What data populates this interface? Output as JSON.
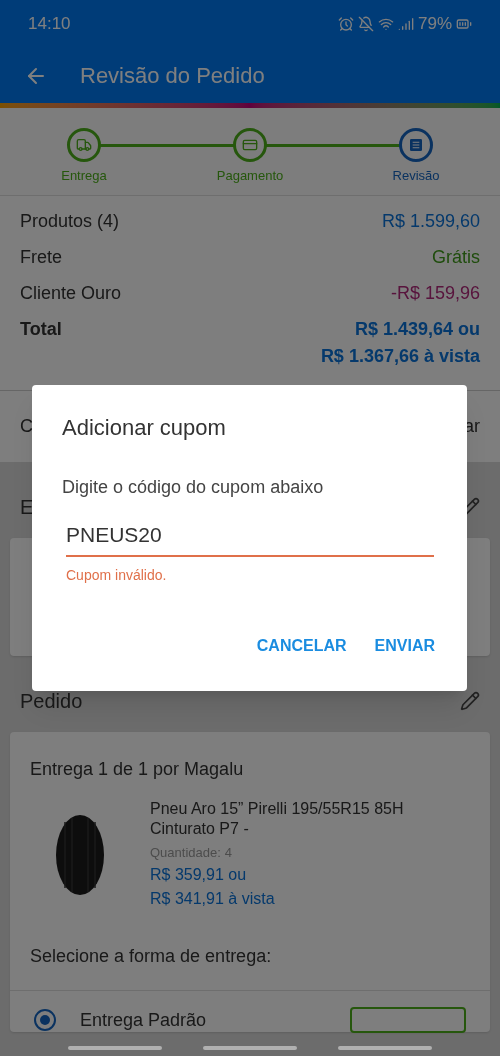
{
  "status_bar": {
    "time": "14:10",
    "battery": "79%"
  },
  "app_bar": {
    "title": "Revisão do Pedido"
  },
  "steps": [
    {
      "label": "Entrega",
      "kind": "truck",
      "selected": false
    },
    {
      "label": "Pagamento",
      "kind": "card",
      "selected": false
    },
    {
      "label": "Revisão",
      "kind": "list",
      "selected": true
    }
  ],
  "summary": [
    {
      "label": "Produtos (4)",
      "value": "R$ 1.599,60",
      "kind": "price"
    },
    {
      "label": "Frete",
      "value": "Grátis",
      "kind": "free"
    },
    {
      "label": "Cliente Ouro",
      "value": "-R$ 159,96",
      "kind": "discount"
    }
  ],
  "total": {
    "label": "Total",
    "values": [
      "R$ 1.439,64 ou",
      "R$ 1.367,66 à vista"
    ]
  },
  "coupon_row": {
    "left": "C",
    "right": "ar"
  },
  "delivery_section": {
    "title": "E"
  },
  "order_section": {
    "title": "Pedido",
    "shipment": "Entrega 1 de 1 por Magalu",
    "product": {
      "name": "Pneu Aro 15” Pirelli 195/55R15 85H Cinturato P7 -",
      "quantity_label": "Quantidade:",
      "quantity": "4",
      "price": "R$ 359,91 ou",
      "cash_price": "R$ 341,91 à vista"
    },
    "delivery_prompt": "Selecione a forma de entrega:",
    "delivery_options": [
      {
        "name": "Entrega Padrão",
        "selected": true
      }
    ]
  },
  "dialog": {
    "title": "Adicionar cupom",
    "message": "Digite o código do cupom abaixo",
    "value": "PNEUS20",
    "error": "Cupom inválido.",
    "buttons": [
      "CANCELAR",
      "ENVIAR"
    ]
  }
}
